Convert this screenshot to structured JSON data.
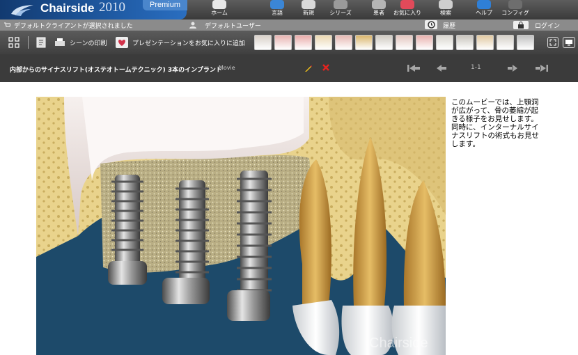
{
  "header": {
    "brand": "Chairside",
    "year": "2010",
    "edition": "Premium",
    "nav": [
      {
        "label": "ホーム",
        "icon": "home-icon",
        "color": "#e8e8e8"
      },
      {
        "label": "言語",
        "icon": "language-icon",
        "color": "#3b86d6"
      },
      {
        "label": "新規",
        "icon": "new-icon",
        "color": "#d9d9d9"
      },
      {
        "label": "シリーズ",
        "icon": "series-icon",
        "color": "#9a9a9a"
      },
      {
        "label": "患者",
        "icon": "patient-icon",
        "color": "#b5b5b5"
      },
      {
        "label": "お気に入り",
        "icon": "favorites-icon",
        "color": "#e14a5a"
      },
      {
        "label": "検索",
        "icon": "search-icon",
        "color": "#cfcfcf"
      },
      {
        "label": "ヘルプ",
        "icon": "help-icon",
        "color": "#2f7fd6"
      },
      {
        "label": "コンフィグ",
        "icon": "config-icon",
        "color": "#6e6e6e"
      }
    ]
  },
  "status": {
    "client": "デフォルトクライアントが選択されました",
    "user": "デフォルトユーザー",
    "history": "履歴",
    "login": "ログイン"
  },
  "toolbar": {
    "print": "シーンの印刷",
    "add_favorite": "プレゼンテーションをお気に入りに追加"
  },
  "movie": {
    "title": "内部からのサイナスリフト(オステオトームテクニック) 3本のインプラント",
    "tag": "Movie",
    "page": "1-1"
  },
  "description": "このムービーでは、上顎洞が広がって、骨の萎縮が起きる様子をお見せします。同時に、インターナルサイナスリフトの術式もお見せします。",
  "scene": {
    "watermark": "Chairside",
    "colors": {
      "background": "#1d4a6a",
      "bone": "#e6cf88",
      "tooth": "#d1a452",
      "gum": "#f2e9e5"
    }
  }
}
